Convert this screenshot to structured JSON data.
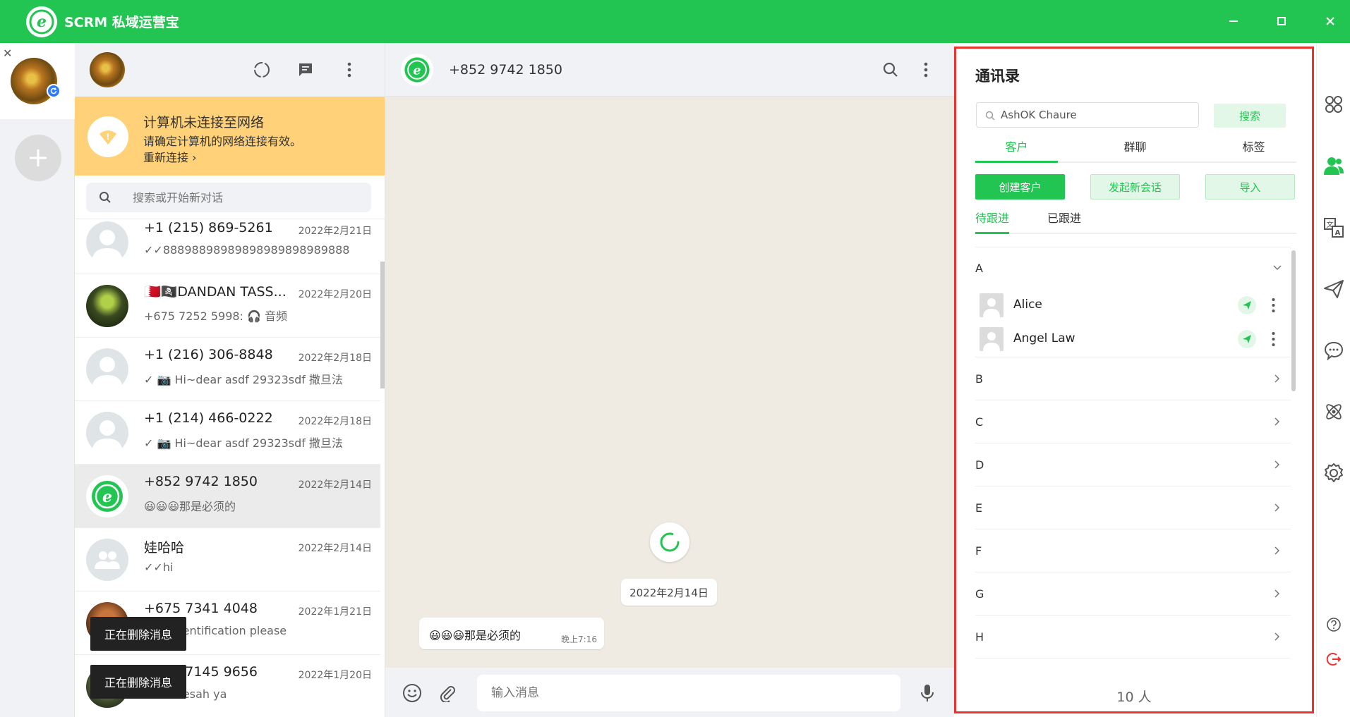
{
  "app": {
    "title": "SCRM 私域运营宝"
  },
  "window": {
    "minimize": "—",
    "maximize": "☐",
    "close": "✕"
  },
  "accounts": {
    "close": "✕"
  },
  "chat_list": {
    "offline": {
      "title": "计算机未连接至网络",
      "desc": "请确定计算机的网络连接有效。",
      "link": "重新连接 ›"
    },
    "search_placeholder": "搜索或开始新对话",
    "items": [
      {
        "name": "+1 (215) 869-5261",
        "date": "2022年2月21日",
        "msg": "✓✓88898898989898989898989888"
      },
      {
        "name": "🇧🇭🏴‍☠️DANDAN TASS...",
        "date": "2022年2月20日",
        "msg": "+675 7252 5998: 🎧 音频"
      },
      {
        "name": "+1 (216) 306-8848",
        "date": "2022年2月18日",
        "msg": "✓ 📷 Hi~dear asdf 29323sdf 撒旦法"
      },
      {
        "name": "+1 (214) 466-0222",
        "date": "2022年2月18日",
        "msg": "✓ 📷 Hi~dear asdf 29323sdf 撒旦法"
      },
      {
        "name": "+852 9742 1850",
        "date": "2022年2月14日",
        "msg": "😃😃😃那是必须的"
      },
      {
        "name": "娃哈哈",
        "date": "2022年2月14日",
        "msg": "✓✓hi"
      },
      {
        "name": "+675 7341 4048",
        "date": "2022年1月21日",
        "msg": "identification please"
      },
      {
        "name": "+675 7145 9656",
        "date": "2022年1月20日",
        "msg": "Wesah ya"
      }
    ],
    "toasts": [
      "正在删除消息",
      "正在删除消息"
    ]
  },
  "chat": {
    "title": "+852 9742 1850",
    "date_chip": "2022年2月14日",
    "message": {
      "text": "😃😃😃那是必须的",
      "time": "晚上7:16"
    },
    "input_placeholder": "输入消息"
  },
  "contacts": {
    "title": "通讯录",
    "search_value": "AshOK Chaure",
    "search_btn": "搜索",
    "tabs": [
      "客户",
      "群聊",
      "标签"
    ],
    "btn_create": "创建客户",
    "btn_new_session": "发起新会话",
    "btn_import": "导入",
    "subtabs": [
      "待跟进",
      "已跟进"
    ],
    "groups": [
      "A",
      "B",
      "C",
      "D",
      "E",
      "F",
      "G",
      "H"
    ],
    "group_a_contacts": [
      "Alice",
      "Angel Law"
    ],
    "count": "10 人"
  },
  "colors": {
    "brand": "#23c552",
    "highlight": "#e8332f",
    "banner": "#ffd279"
  }
}
